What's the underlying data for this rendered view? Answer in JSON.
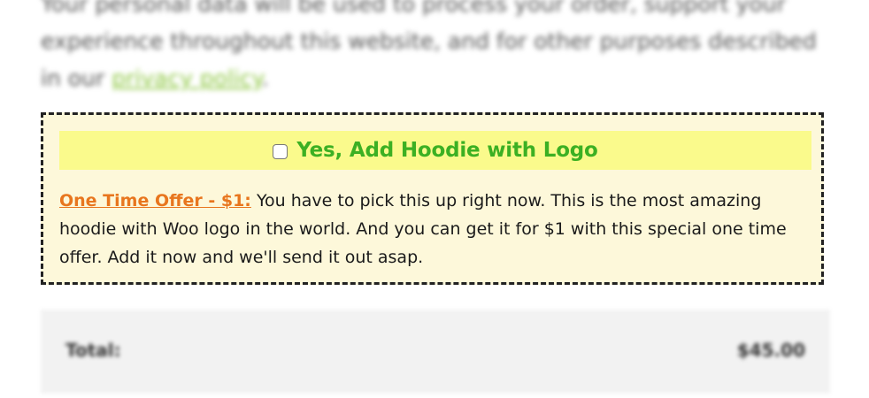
{
  "privacy_notice": {
    "text": "Your personal data will be used to process your order, support your experience throughout this website, and for other purposes described in our ",
    "link_text": "privacy policy",
    "trailing": "."
  },
  "offer": {
    "checkbox_checked": false,
    "title": "Yes, Add Hoodie with Logo",
    "lead": "One Time Offer - $1:",
    "description": " You have to pick this up right now. This is the most amazing hoodie with Woo logo in the world. And you can get it for $1 with this special one time offer. Add it now and we'll send it out asap.",
    "colors": {
      "header_bg": "#fafa8c",
      "box_bg": "#fdf8da",
      "title": "#3cb023",
      "lead": "#e8761e"
    }
  },
  "order_summary": {
    "total_label": "Total:",
    "total_value": "$45.00"
  }
}
